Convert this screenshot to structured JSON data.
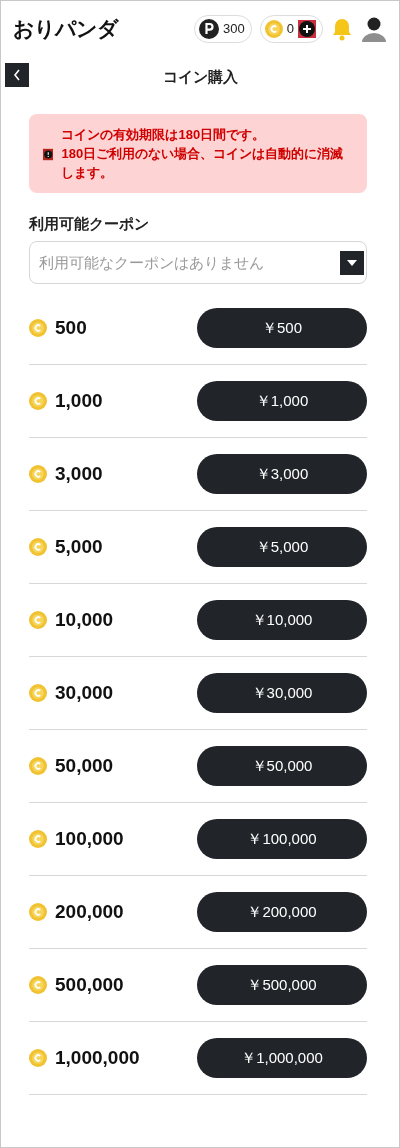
{
  "header": {
    "logo": "おりパンダ",
    "points": "300",
    "coins": "0"
  },
  "title": "コイン購入",
  "alert": {
    "lines": [
      "コインの有効期限は180日間です。",
      "180日ご利用のない場合、コインは自動的に消滅します。"
    ]
  },
  "coupon": {
    "label": "利用可能クーポン",
    "placeholder": "利用可能なクーポンはありません"
  },
  "packages": [
    {
      "coins": "500",
      "price": "￥500"
    },
    {
      "coins": "1,000",
      "price": "￥1,000"
    },
    {
      "coins": "3,000",
      "price": "￥3,000"
    },
    {
      "coins": "5,000",
      "price": "￥5,000"
    },
    {
      "coins": "10,000",
      "price": "￥10,000"
    },
    {
      "coins": "30,000",
      "price": "￥30,000"
    },
    {
      "coins": "50,000",
      "price": "￥50,000"
    },
    {
      "coins": "100,000",
      "price": "￥100,000"
    },
    {
      "coins": "200,000",
      "price": "￥200,000"
    },
    {
      "coins": "500,000",
      "price": "￥500,000"
    },
    {
      "coins": "1,000,000",
      "price": "￥1,000,000"
    }
  ]
}
